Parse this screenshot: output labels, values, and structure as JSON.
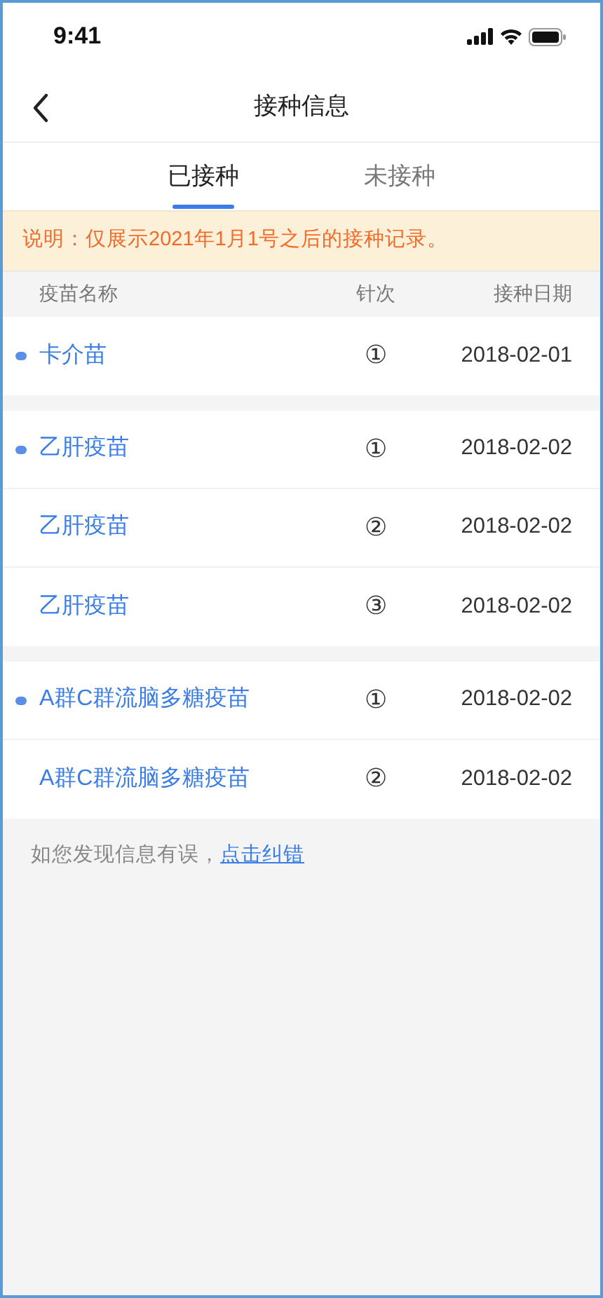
{
  "status_bar": {
    "time": "9:41"
  },
  "nav": {
    "title": "接种信息"
  },
  "tabs": [
    {
      "label": "已接种",
      "selected": true
    },
    {
      "label": "未接种",
      "selected": false
    }
  ],
  "notice": "说明：仅展示2021年1月1号之后的接种记录。",
  "table": {
    "columns": [
      "疫苗名称",
      "针次",
      "接种日期"
    ],
    "groups": [
      {
        "rows": [
          {
            "name": "卡介苗",
            "dose": "①",
            "date": "2018-02-01",
            "marked": true
          }
        ]
      },
      {
        "rows": [
          {
            "name": "乙肝疫苗",
            "dose": "①",
            "date": "2018-02-02",
            "marked": true
          },
          {
            "name": "乙肝疫苗",
            "dose": "②",
            "date": "2018-02-02",
            "marked": false
          },
          {
            "name": "乙肝疫苗",
            "dose": "③",
            "date": "2018-02-02",
            "marked": false
          }
        ]
      },
      {
        "rows": [
          {
            "name": "A群C群流脑多糖疫苗",
            "dose": "①",
            "date": "2018-02-02",
            "marked": true
          },
          {
            "name": "A群C群流脑多糖疫苗",
            "dose": "②",
            "date": "2018-02-02",
            "marked": false
          }
        ]
      }
    ]
  },
  "footer": {
    "text": "如您发现信息有误，",
    "link": "点击纠错"
  }
}
